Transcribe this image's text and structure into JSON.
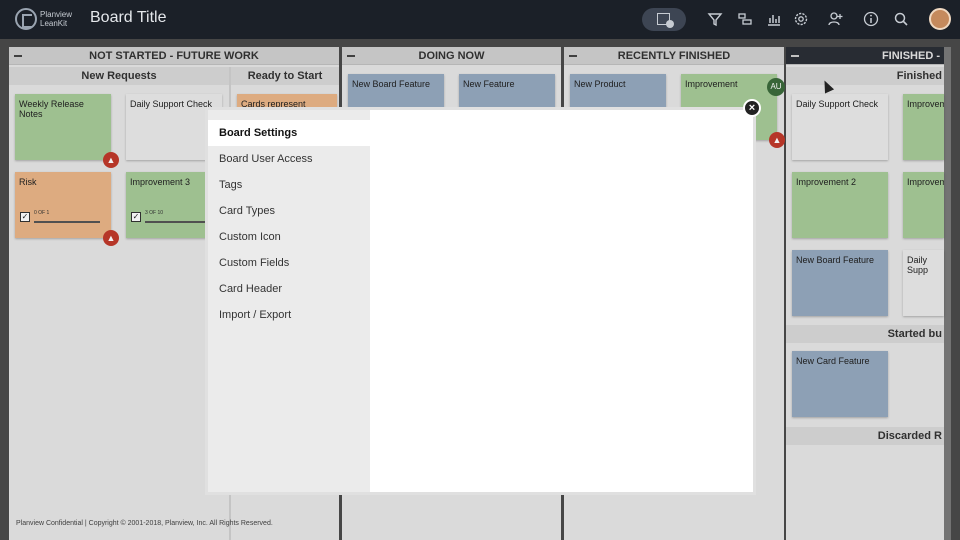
{
  "header": {
    "brand_line1": "Planview",
    "brand_line2": "LeanKit",
    "board_title": "Board Title",
    "icons": [
      "new-card-icon",
      "filter-icon",
      "cards-icon",
      "analytics-icon",
      "settings-icon",
      "add-user-icon",
      "info-icon",
      "search-icon",
      "avatar"
    ]
  },
  "lane_groups": [
    {
      "title": "NOT STARTED - FUTURE WORK",
      "lanes": [
        "New Requests",
        "Ready to Start"
      ]
    },
    {
      "title": "DOING NOW",
      "lanes": []
    },
    {
      "title": "RECENTLY FINISHED",
      "lanes": []
    },
    {
      "title": "FINISHED -",
      "lanes": [
        "Finished",
        "Started bu",
        "Discarded R"
      ]
    }
  ],
  "cards": {
    "c1": "Weekly Release Notes",
    "c2": "Daily Support Check",
    "c3": "Cards represent",
    "c4": "Risk",
    "c5": "Improvement 3",
    "c6": "New Board Feature",
    "c7": "New Feature",
    "c8": "New Product",
    "c9": "Improvement",
    "c10": "Daily Support Check",
    "c11": "Improvem",
    "c12": "Improvement 2",
    "c13": "Improvem",
    "c14": "New Board Feature",
    "c15": "Daily Supp",
    "c16": "New Card Feature"
  },
  "progress": {
    "risk": "0 OF 1",
    "improvement3": "3 OF 10"
  },
  "badge": "AU",
  "modal": {
    "nav_items": [
      "Board Settings",
      "Board User Access",
      "Tags",
      "Card Types",
      "Custom Icon",
      "Custom Fields",
      "Card Header",
      "Import / Export"
    ],
    "active_index": 0,
    "close_symbol": "×"
  },
  "footer": "Planview Confidential | Copyright © 2001-2018, Planview, Inc. All Rights Reserved.",
  "colors": {
    "topbar": "#1b2028",
    "card_green": "#a7cb98",
    "card_orange": "#e9b587",
    "card_blue": "#95a9bf",
    "card_white": "#e9e9e9"
  }
}
